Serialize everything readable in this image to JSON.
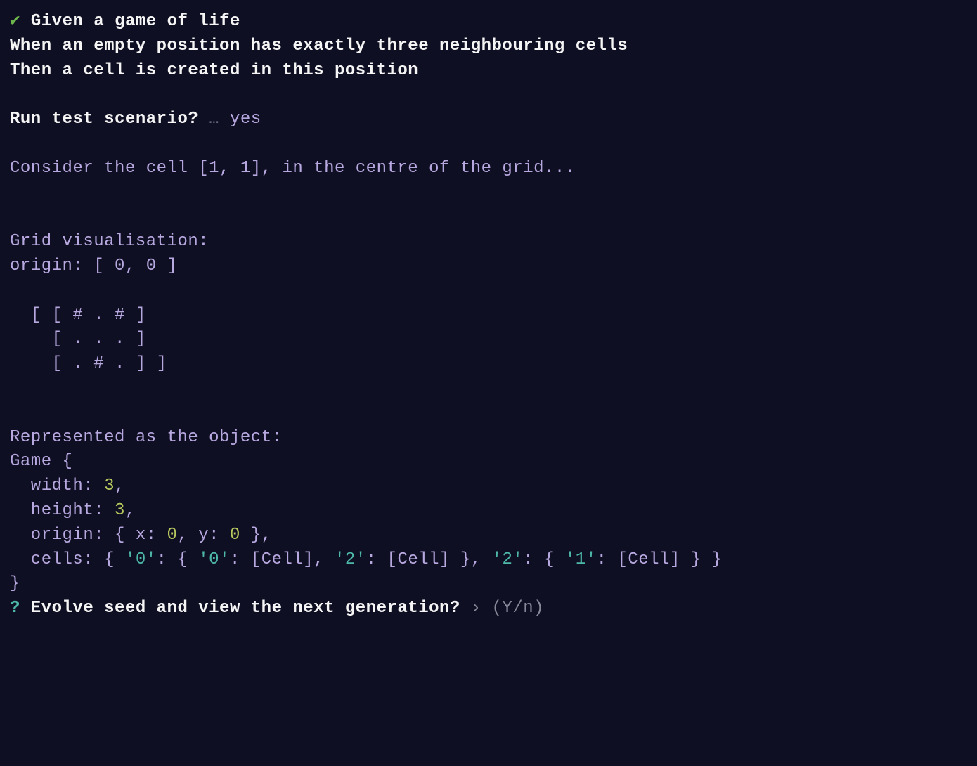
{
  "scenario": {
    "checkmark": "✔",
    "given": "Given a game of life",
    "when": "When an empty position has exactly three neighbouring cells",
    "then": "Then a cell is created in this position"
  },
  "prompt1": {
    "question": "Run test scenario?",
    "ellipsis": "…",
    "answer": "yes"
  },
  "consider": "Consider the cell [1, 1], in the centre of the grid...",
  "grid_vis_label": "Grid visualisation:",
  "origin_label": "origin: [ 0, 0 ]",
  "grid_row1": "  [ [ # . # ]",
  "grid_row2": "    [ . . . ]",
  "grid_row3": "    [ . # . ] ]",
  "represented_label": "Represented as the object:",
  "game_open": "Game {",
  "width_key": "  width: ",
  "width_val": "3",
  "width_comma": ",",
  "height_key": "  height: ",
  "height_val": "3",
  "height_comma": ",",
  "origin_key": "  origin: { x: ",
  "origin_x": "0",
  "origin_mid": ", y: ",
  "origin_y": "0",
  "origin_end": " },",
  "cells_key": "  cells: { ",
  "cells_q0a": "'0'",
  "cells_colon1": ": { ",
  "cells_q0b": "'0'",
  "cells_colon2": ": [Cell], ",
  "cells_q2a": "'2'",
  "cells_colon3": ": [Cell] }, ",
  "cells_q2b": "'2'",
  "cells_colon4": ": { ",
  "cells_q1": "'1'",
  "cells_colon5": ": [Cell] } }",
  "game_close": "}",
  "prompt2": {
    "qmark": "?",
    "question": " Evolve seed and view the next generation? ",
    "arrow": "›",
    "hint": " (Y/n)"
  }
}
